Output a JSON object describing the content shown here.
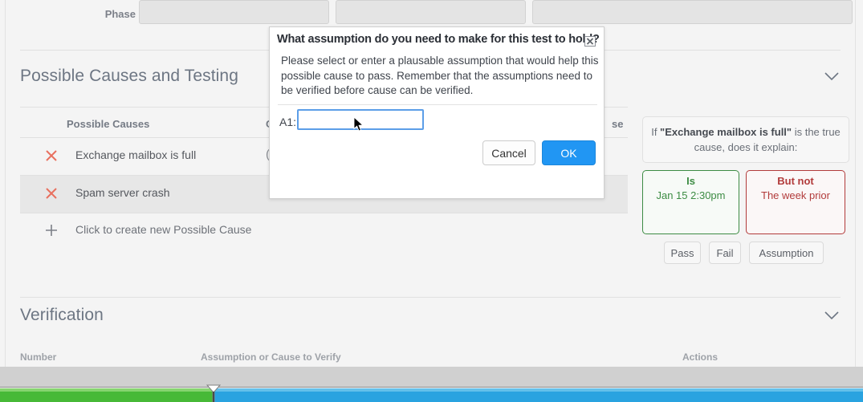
{
  "form": {
    "phase_label": "Phase",
    "fields": [
      "",
      "",
      ""
    ]
  },
  "sections": {
    "possible_causes": {
      "title": "Possible Causes and Testing",
      "collapse_icon": "chevron-down-icon",
      "columns": [
        "Possible Causes",
        "Ol",
        "se"
      ],
      "rows": [
        {
          "delete_icon": "x-icon",
          "label": "Exchange mailbox is full",
          "observation": "("
        },
        {
          "delete_icon": "x-icon",
          "label": "Spam server crash",
          "observation": ""
        }
      ],
      "add_row": {
        "icon": "plus-icon",
        "label": "Click to create new Possible Cause"
      }
    },
    "verification": {
      "title": "Verification",
      "collapse_icon": "chevron-down-icon",
      "columns": [
        "Number",
        "Assumption or Cause to Verify",
        "Actions"
      ]
    }
  },
  "decision_panel": {
    "question_prefix": "If ",
    "question_cause": "\"Exchange mailbox is full\"",
    "question_suffix": " is the true cause, does it explain:",
    "is_box": {
      "title": "Is",
      "value": "Jan 15 2:30pm"
    },
    "but_not_box": {
      "title": "But not",
      "value": "The week prior"
    },
    "buttons": [
      "Pass",
      "Fail",
      "Assumption"
    ]
  },
  "modal": {
    "title": "What assumption do you need to make for this test to hold?",
    "close_icon": "close-box-icon",
    "body": "Please select or enter a plausable assumption that would help this possible cause to pass. Remember that the assumptions need to be verified before cause can be verified.",
    "field_label": "A1:",
    "field_value": "",
    "field_placeholder": "",
    "cancel_label": "Cancel",
    "ok_label": "OK"
  },
  "statusbar": {
    "progress_percent": 25,
    "done_color": "#47b937",
    "remaining_color": "#29a3e0"
  }
}
